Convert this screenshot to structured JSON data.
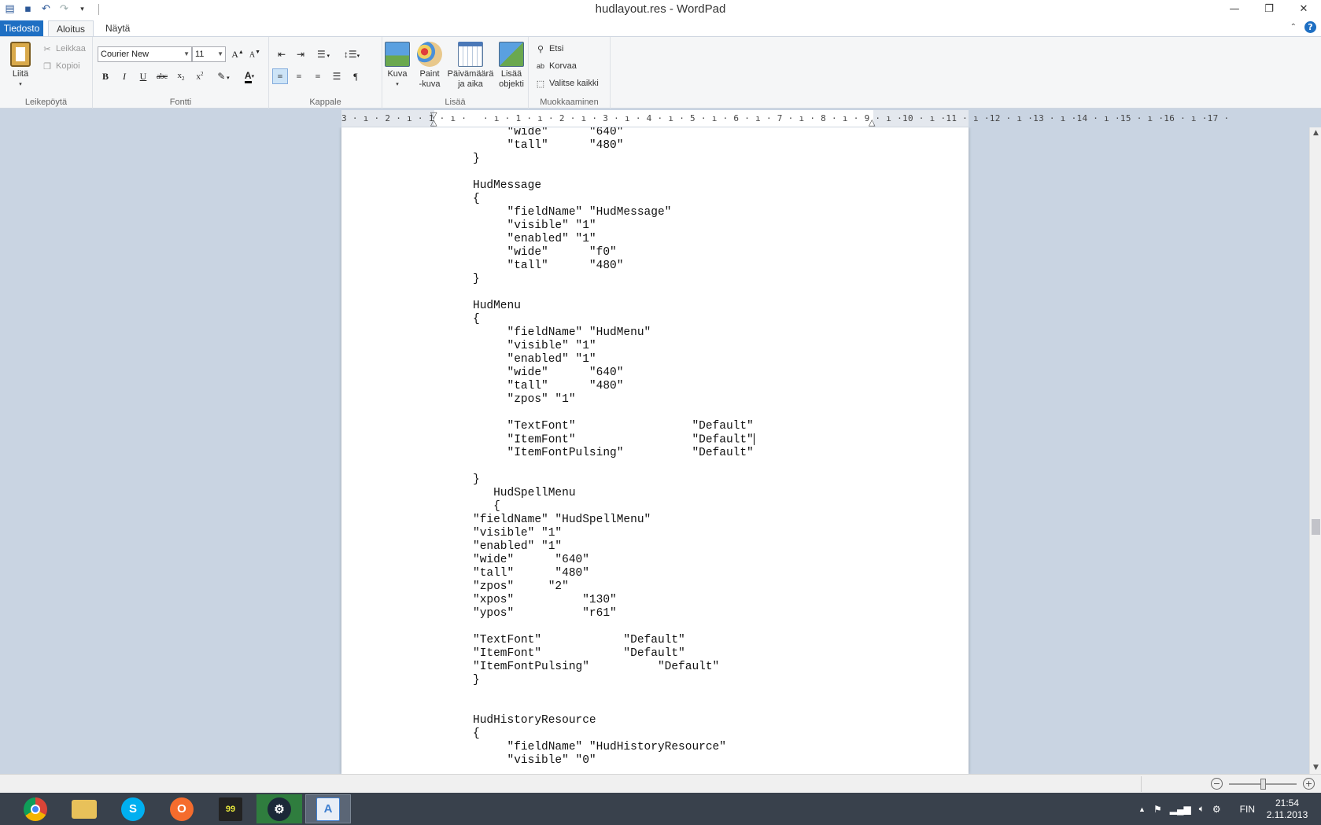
{
  "window": {
    "title": "hudlayout.res - WordPad"
  },
  "qat": {
    "icons": [
      "wordpad-icon",
      "save-icon",
      "undo-icon",
      "redo-icon",
      "customize-icon"
    ]
  },
  "tabs": {
    "file": "Tiedosto",
    "home": "Aloitus",
    "view": "Näytä"
  },
  "ribbon": {
    "clipboard": {
      "label": "Leikepöytä",
      "paste": "Liitä",
      "cut": "Leikkaa",
      "copy": "Kopioi"
    },
    "font": {
      "label": "Fontti",
      "family": "Courier New",
      "size": "11"
    },
    "paragraph": {
      "label": "Kappale"
    },
    "insert": {
      "label": "Lisää",
      "picture": "Kuva",
      "paint_line1": "Paint",
      "paint_line2": "-kuva",
      "datetime_line1": "Päivämäärä",
      "datetime_line2": "ja aika",
      "object_line1": "Lisää",
      "object_line2": "objekti"
    },
    "editing": {
      "label": "Muokkaaminen",
      "find": "Etsi",
      "replace": "Korvaa",
      "select_all": "Valitse kaikki"
    }
  },
  "ruler": {
    "text": "3 · ı · 2 · ı · 1 · ı ·   · ı · 1 · ı · 2 · ı · 3 · ı · 4 · ı · 5 · ı · 6 · ı · 7 · ı · 8 · ı · 9 · ı ·10 · ı ·11 · ı ·12 · ı ·13 · ı ·14 · ı ·15 · ı ·16 · ı ·17 ·"
  },
  "document": {
    "lines_before_caret": "     \"wide\"      \"640\"\n     \"tall\"      \"480\"\n}\n\nHudMessage\n{\n     \"fieldName\" \"HudMessage\"\n     \"visible\" \"1\"\n     \"enabled\" \"1\"\n     \"wide\"      \"f0\"\n     \"tall\"      \"480\"\n}\n\nHudMenu\n{\n     \"fieldName\" \"HudMenu\"\n     \"visible\" \"1\"\n     \"enabled\" \"1\"\n     \"wide\"      \"640\"\n     \"tall\"      \"480\"\n     \"zpos\" \"1\"\n\n     \"TextFont\"                 \"Default\"\n     \"ItemFont\"                 \"Default\"",
    "lines_after_caret": "\n     \"ItemFontPulsing\"          \"Default\"\n\n}\n   HudSpellMenu\n   {\n\"fieldName\" \"HudSpellMenu\"\n\"visible\" \"1\"\n\"enabled\" \"1\"\n\"wide\"      \"640\"\n\"tall\"      \"480\"\n\"zpos\"     \"2\"\n\"xpos\"          \"130\"\n\"ypos\"          \"r61\"\n\n\"TextFont\"            \"Default\"\n\"ItemFont\"            \"Default\"\n\"ItemFontPulsing\"          \"Default\"\n}\n\n\nHudHistoryResource\n{\n     \"fieldName\" \"HudHistoryResource\"\n     \"visible\" \"0\""
  },
  "statusbar": {
    "zoom_minus": "−",
    "zoom_plus": "+"
  },
  "taskbar": {
    "apps": [
      {
        "name": "chrome-icon",
        "glyph": "●",
        "color": "#dd4b39"
      },
      {
        "name": "file-explorer-icon",
        "glyph": "▭",
        "color": "#e8c15a"
      },
      {
        "name": "skype-icon",
        "glyph": "S",
        "color": "#00aff0"
      },
      {
        "name": "origin-icon",
        "glyph": "O",
        "color": "#f56c2d"
      },
      {
        "name": "fraps-icon",
        "glyph": "99",
        "color": "#d2d23c"
      },
      {
        "name": "steam-icon",
        "glyph": "⚙",
        "color": "#1b2838"
      },
      {
        "name": "wordpad-taskbar-icon",
        "glyph": "A",
        "color": "#3f7fd0"
      }
    ],
    "language": "FIN",
    "time": "21:54",
    "date": "2.11.2013"
  }
}
